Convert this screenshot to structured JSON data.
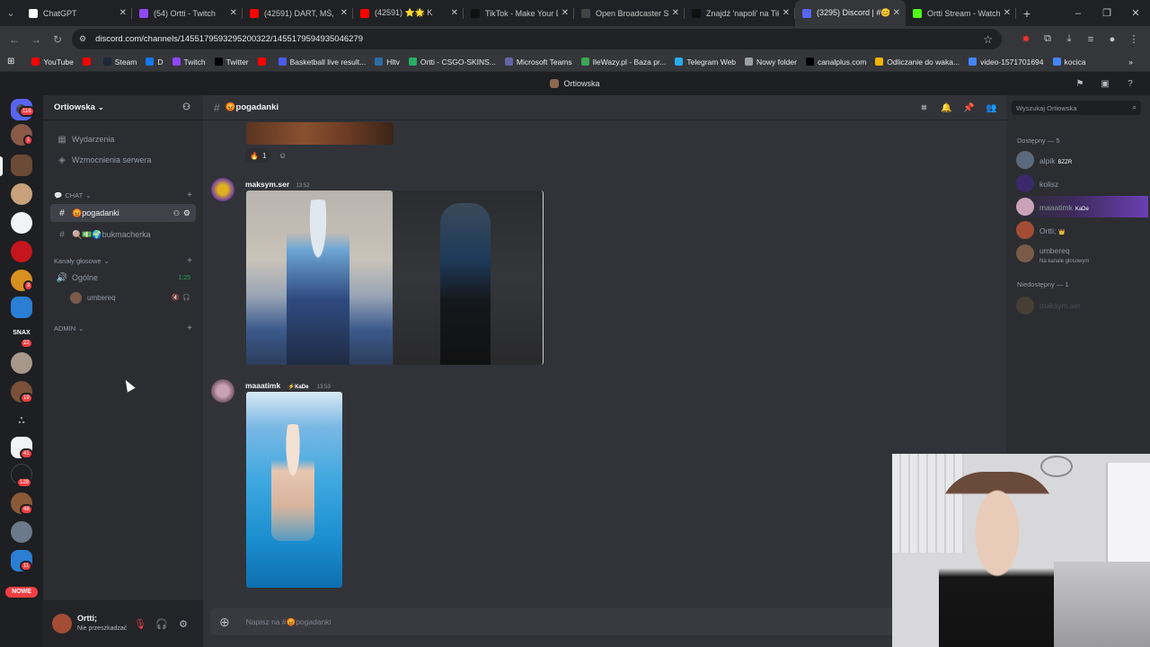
{
  "browser": {
    "tabs": [
      {
        "title": "ChatGPT",
        "color": "#ffffff",
        "active": false
      },
      {
        "title": "(54) Ortti - Twitch",
        "color": "#9146ff",
        "active": false
      },
      {
        "title": "(42591) DART, MŚ, SE",
        "color": "#ff0000",
        "active": false
      },
      {
        "title": "(42591) ⭐🌟 K",
        "color": "#ff0000",
        "active": false
      },
      {
        "title": "TikTok - Make Your D",
        "color": "#111111",
        "active": false
      },
      {
        "title": "Open Broadcaster Sc",
        "color": "#444444",
        "active": false
      },
      {
        "title": "Znajdź 'napoli' na Tik",
        "color": "#111111",
        "active": false
      },
      {
        "title": "(3295) Discord | #😊",
        "color": "#5865f2",
        "active": true
      },
      {
        "title": "Ortti Stream - Watch",
        "color": "#53fc18",
        "active": false
      }
    ],
    "url": "discord.com/channels/1455179593295200322/1455179594935046279",
    "bookmarks": [
      {
        "label": "YouTube",
        "color": "#ff0000"
      },
      {
        "label": "",
        "color": "#ff0000"
      },
      {
        "label": "Steam",
        "color": "#1b2838"
      },
      {
        "label": "D",
        "color": "#1877f2"
      },
      {
        "label": "Twitch",
        "color": "#9146ff"
      },
      {
        "label": "Twitter",
        "color": "#000000"
      },
      {
        "label": "",
        "color": "#ff0000"
      },
      {
        "label": "Basketball live result...",
        "color": "#4a5cf0"
      },
      {
        "label": "Hltv",
        "color": "#2d6da3"
      },
      {
        "label": "Ortti - CSGO-SKINS...",
        "color": "#27ae60"
      },
      {
        "label": "Microsoft Teams",
        "color": "#6264a7"
      },
      {
        "label": "IleWazy.pl - Baza pr...",
        "color": "#3aa655"
      },
      {
        "label": "Telegram Web",
        "color": "#2aabee"
      },
      {
        "label": "Nowy folder",
        "color": "#9aa0a6"
      },
      {
        "label": "canalplus.com",
        "color": "#000000"
      },
      {
        "label": "Odliczanie do waka...",
        "color": "#f4b400"
      },
      {
        "label": "video-1571701694",
        "color": "#4285f4"
      },
      {
        "label": "kocica",
        "color": "#4285f4"
      }
    ]
  },
  "discord": {
    "window_title": "Ortiowska",
    "server_name": "Ortiowska",
    "sidebar": {
      "top_items": [
        "Wydarzenia",
        "Wzmocnienia serwera"
      ],
      "chat_category": "CHAT",
      "channels": [
        "😡pogadanki",
        "🍭💵🌍bukmacherka"
      ],
      "voice_category": "Kanały głosowe",
      "voice_channel": "Ogólne",
      "voice_time": "1:25",
      "voice_user": "umbereq",
      "admin_category": "ADMIN"
    },
    "rail_badges": [
      "116",
      "1",
      "3",
      "22",
      "19",
      "41",
      "128",
      "48",
      "11"
    ],
    "rail_snax": "SNAX",
    "rail_new": "NOWE",
    "user": {
      "name": "Ortti;",
      "status": "Nie przeszkadzać"
    },
    "channel_header": "😡pogadanki",
    "messages": [
      {
        "author": "maksym.ser",
        "time": "13:52"
      },
      {
        "author": "maaatimk",
        "badge": "KaDe",
        "time": "13:53"
      }
    ],
    "reaction": {
      "emoji": "🔥",
      "count": "1"
    },
    "composer_placeholder": "Napisz na #😡pogadanki",
    "members": {
      "search_placeholder": "Wyszukaj Ortiowska",
      "online_header": "Dostępny — 5",
      "online": [
        {
          "name": "alpik",
          "badge": "BZZR",
          "sub": ""
        },
        {
          "name": "kolisz",
          "badge": "",
          "sub": ""
        },
        {
          "name": "maaatimk",
          "badge": "KaDe",
          "sub": ""
        },
        {
          "name": "Ortti;",
          "badge": "👑",
          "sub": ""
        },
        {
          "name": "umbereq",
          "badge": "",
          "sub": "Na kanale głosowym"
        }
      ],
      "offline_header": "Niedostępny — 1",
      "offline": [
        {
          "name": "maksym.ser"
        }
      ]
    }
  }
}
